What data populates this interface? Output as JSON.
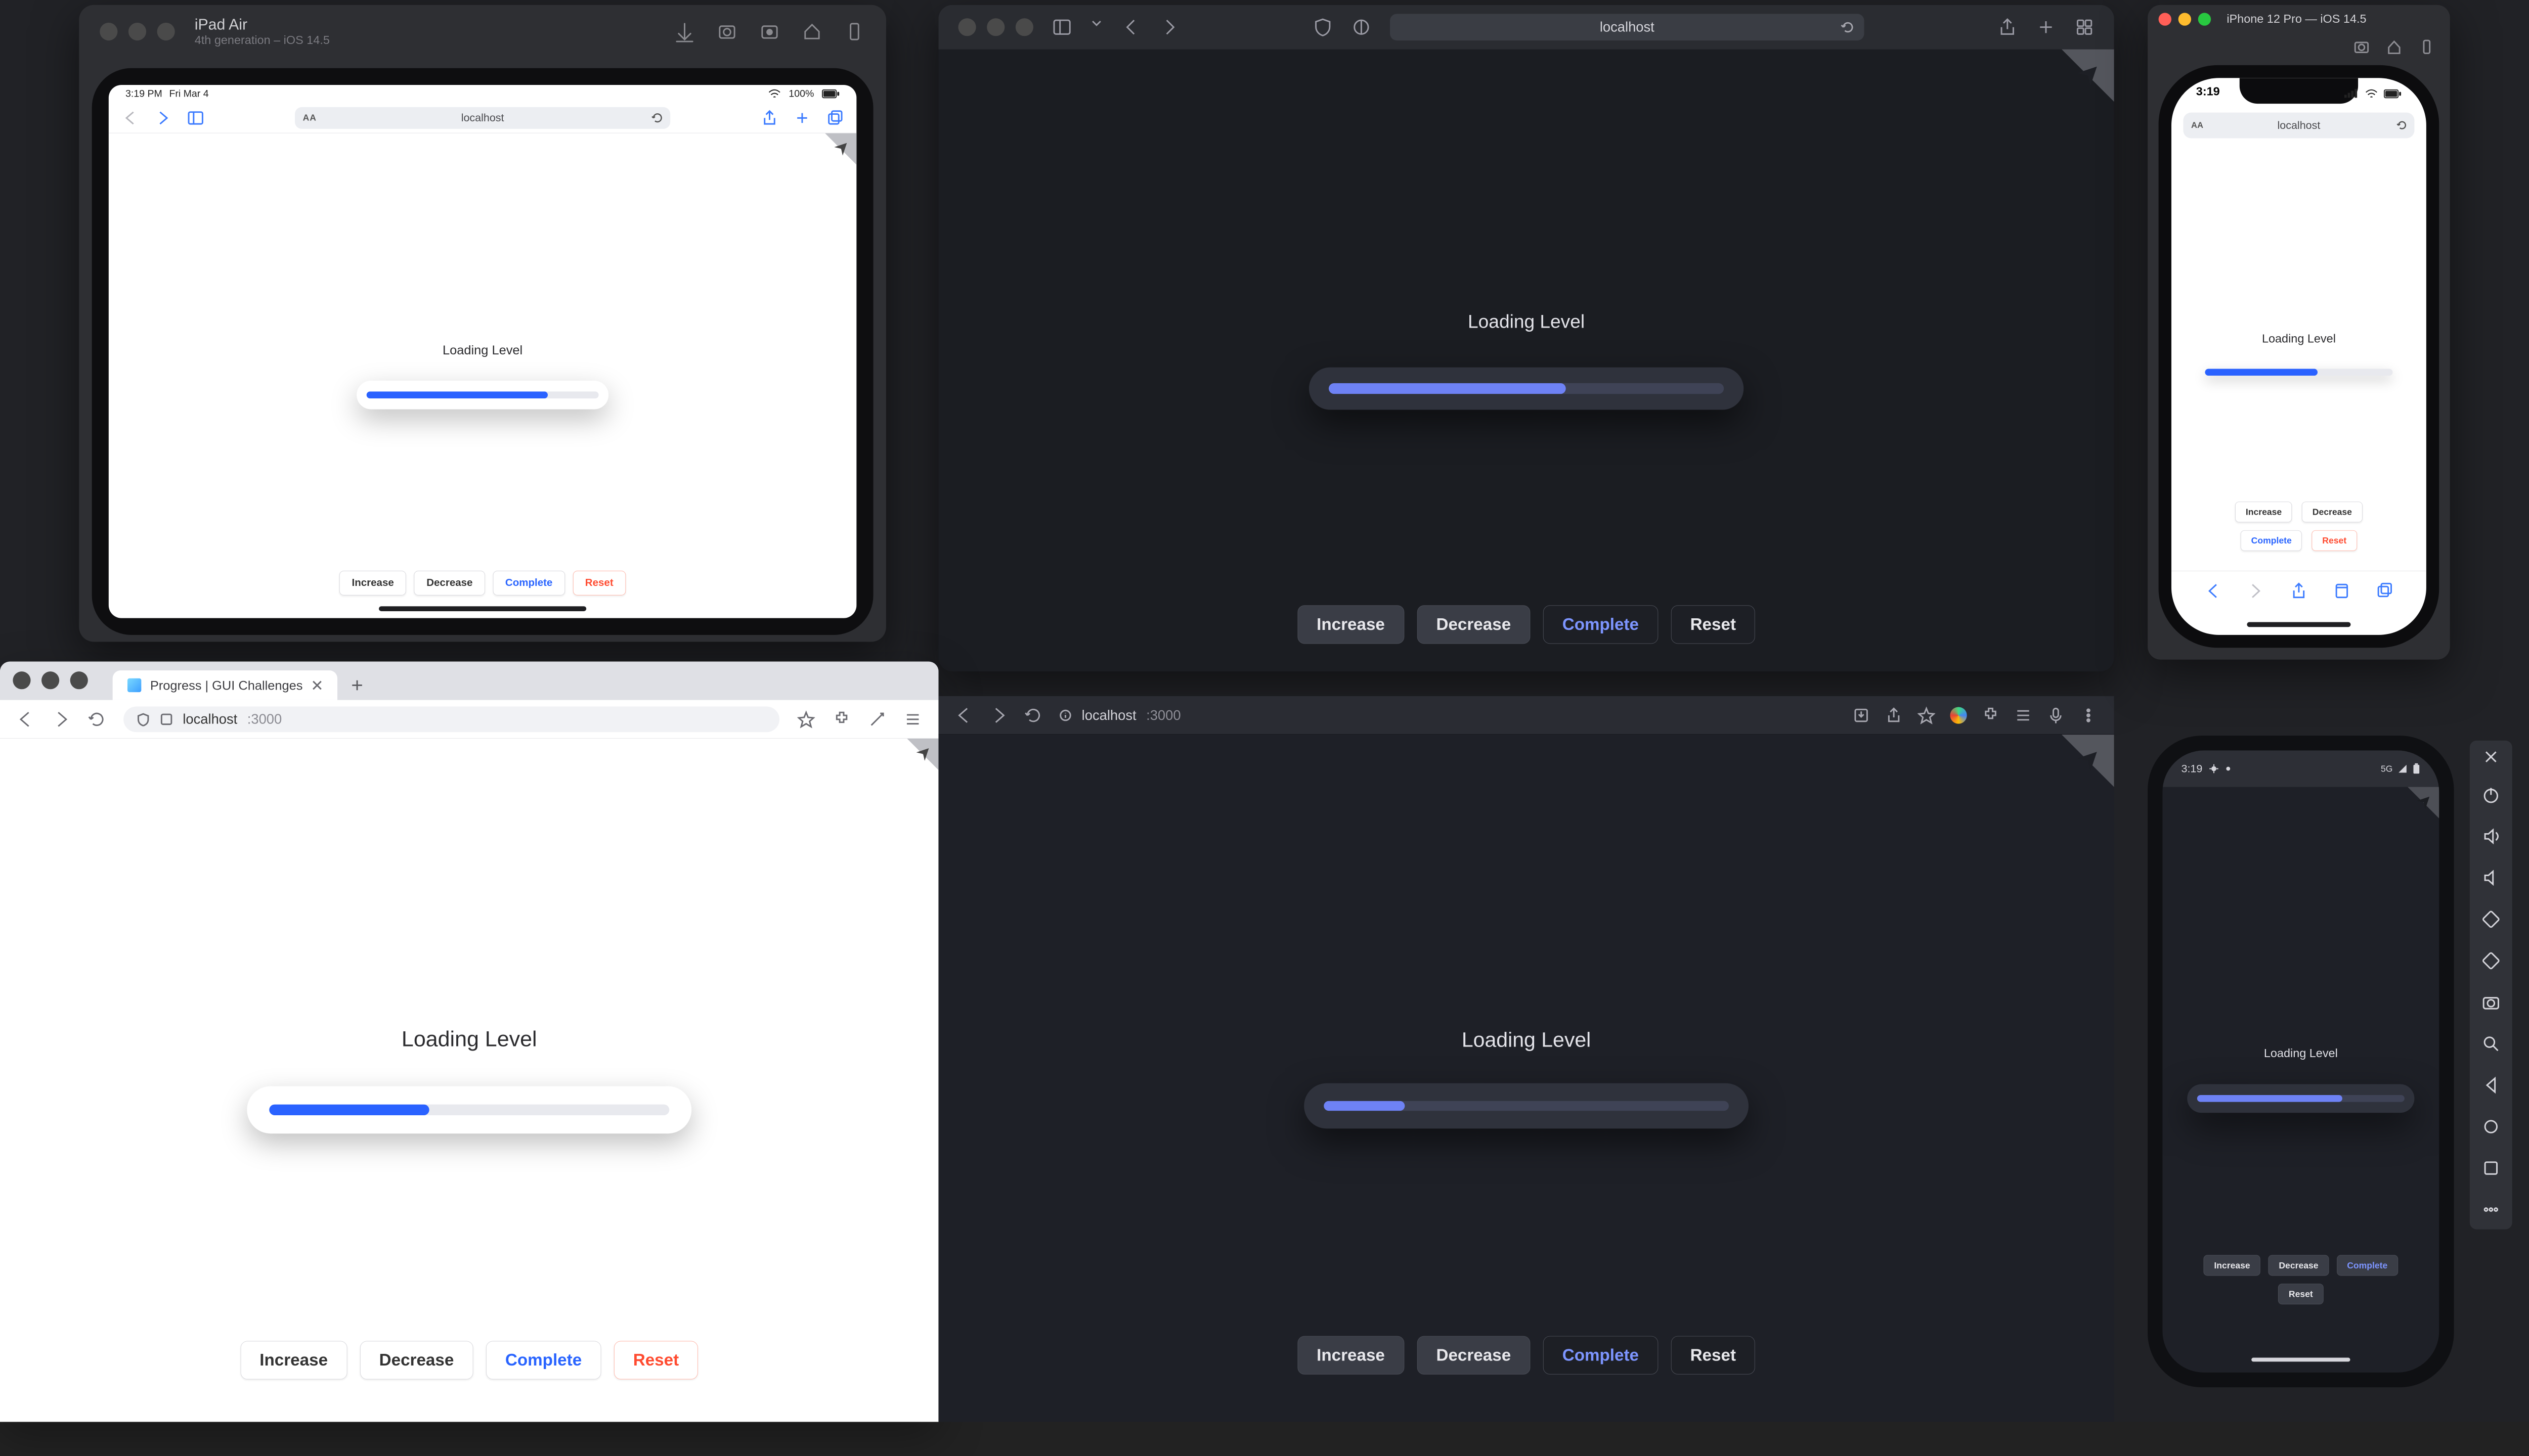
{
  "demo": {
    "heading": "Loading Level",
    "buttons": {
      "increase": "Increase",
      "decrease": "Decrease",
      "complete": "Complete",
      "reset": "Reset"
    }
  },
  "panel1": {
    "window": {
      "title": "iPad Air",
      "subtitle": "4th generation – iOS 14.5"
    },
    "status": {
      "time": "3:19 PM",
      "date": "Fri Mar 4",
      "wifi": "wifi-icon",
      "battery": "100%"
    },
    "safari": {
      "url": "localhost",
      "aa": "AA"
    },
    "progress_pct": 78
  },
  "panel2": {
    "safari": {
      "url": "localhost"
    },
    "progress_pct": 60
  },
  "panel3": {
    "tab_title": "Progress | GUI Challenges",
    "address": {
      "host": "localhost",
      "port": ":3000"
    },
    "progress_pct": 40
  },
  "panel4": {
    "address": {
      "host": "localhost",
      "port": ":3000"
    },
    "progress_pct": 20
  },
  "panel5": {
    "window_title": "iPhone 12 Pro — iOS 14.5",
    "status": {
      "time": "3:19"
    },
    "safari": {
      "url": "localhost",
      "aa": "AA"
    },
    "progress_pct": 60
  },
  "panel6": {
    "status": {
      "time": "3:19",
      "debug": "debug-icon",
      "net": "5G"
    },
    "progress_pct": 70
  },
  "emulator_toolbar": [
    "close",
    "power",
    "volume-up",
    "volume-down",
    "rotate-left",
    "rotate-right",
    "camera",
    "zoom",
    "back",
    "home",
    "overview",
    "more"
  ]
}
